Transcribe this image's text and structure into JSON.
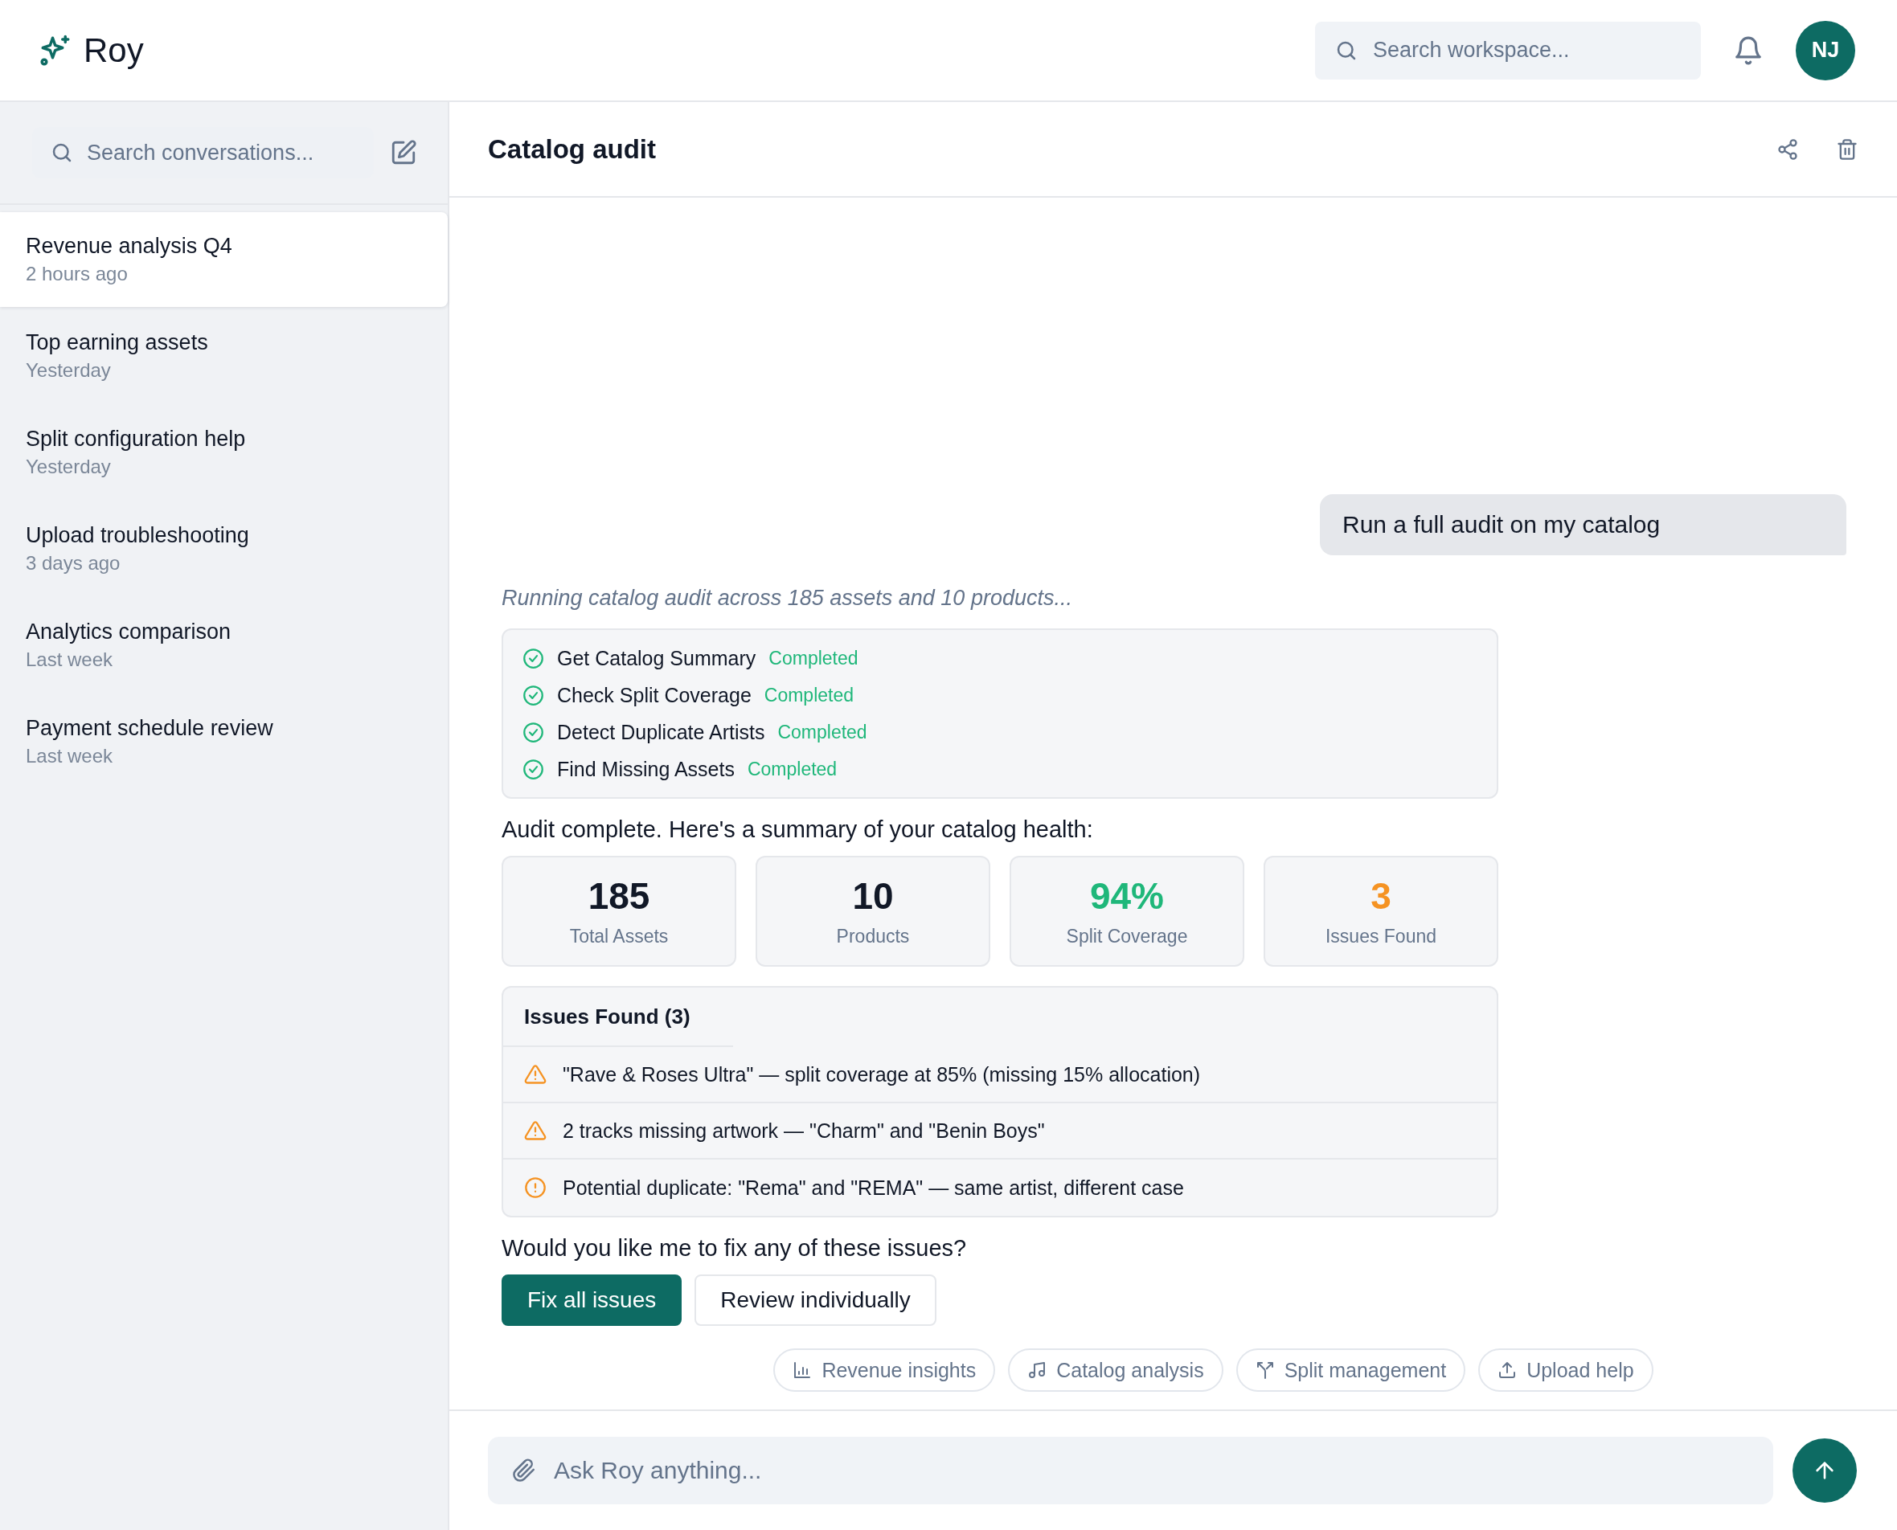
{
  "header": {
    "logo_text": "Roy",
    "search": {
      "placeholder": "Search workspace..."
    },
    "avatar": "NJ"
  },
  "sidebar": {
    "search": {
      "placeholder": "Search conversations..."
    },
    "conversations": [
      {
        "title": "Revenue analysis Q4",
        "time": "2 hours ago",
        "selected": true
      },
      {
        "title": "Top earning assets",
        "time": "Yesterday",
        "selected": false
      },
      {
        "title": "Split configuration help",
        "time": "Yesterday",
        "selected": false
      },
      {
        "title": "Upload troubleshooting",
        "time": "3 days ago",
        "selected": false
      },
      {
        "title": "Analytics comparison",
        "time": "Last week",
        "selected": false
      },
      {
        "title": "Payment schedule review",
        "time": "Last week",
        "selected": false
      }
    ]
  },
  "chat": {
    "title": "Catalog audit",
    "user_message": "Run a full audit on my catalog",
    "status_text": "Running catalog audit across 185 assets and 10 products...",
    "tool_calls": [
      {
        "name": "Get Catalog Summary",
        "status": "Completed",
        "done": true
      },
      {
        "name": "Check Split Coverage",
        "status": "Completed",
        "done": true
      },
      {
        "name": "Detect Duplicate Artists",
        "status": "Completed",
        "done": true
      },
      {
        "name": "Find Missing Assets",
        "status": "Completed",
        "done": true
      }
    ],
    "summary_text": "Audit complete. Here's a summary of your catalog health:",
    "stats": [
      {
        "value": "185",
        "label": "Total Assets",
        "kind": "neutral"
      },
      {
        "value": "10",
        "label": "Products",
        "kind": "neutral"
      },
      {
        "value": "94%",
        "label": "Split Coverage",
        "kind": "good"
      },
      {
        "value": "3",
        "label": "Issues Found",
        "kind": "warning"
      }
    ],
    "issues": {
      "title": "Issues Found (3)",
      "items": [
        {
          "kind": "warning",
          "text": "\"Rave & Roses Ultra\" — split coverage at 85% (missing 15% allocation)"
        },
        {
          "kind": "warning",
          "text": "2 tracks missing artwork — \"Charm\" and \"Benin Boys\""
        },
        {
          "kind": "notice",
          "text": "Potential duplicate: \"Rema\" and \"REMA\" — same artist, different case"
        }
      ]
    },
    "question": "Would you like me to fix any of these issues?",
    "actions": [
      {
        "label": "Fix all issues",
        "kind": "primary"
      },
      {
        "label": "Review individually",
        "kind": "secondary"
      }
    ],
    "suggestions": [
      {
        "label": "Revenue insights",
        "kind": "chart"
      },
      {
        "label": "Catalog analysis",
        "kind": "music"
      },
      {
        "label": "Split management",
        "kind": "split"
      },
      {
        "label": "Upload help",
        "kind": "upload"
      }
    ],
    "composer": {
      "placeholder": "Ask Roy anything..."
    }
  }
}
